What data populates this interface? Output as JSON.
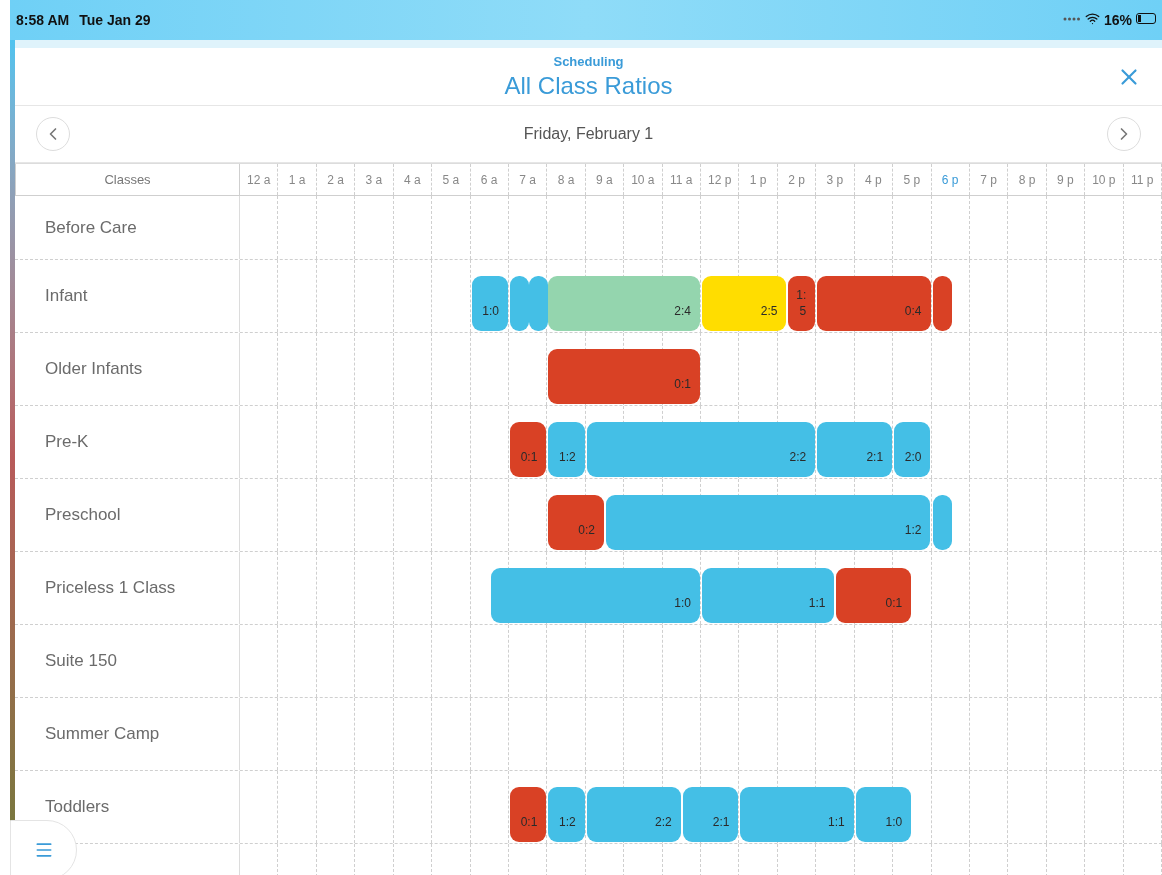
{
  "status_bar": {
    "time": "8:58 AM",
    "date": "Tue Jan 29",
    "battery": "16%"
  },
  "header": {
    "section": "Scheduling",
    "title": "All Class Ratios"
  },
  "date_nav": {
    "date": "Friday, February 1"
  },
  "grid": {
    "corner": "Classes",
    "hours": [
      {
        "label": "12 a",
        "selected": false
      },
      {
        "label": "1 a",
        "selected": false
      },
      {
        "label": "2 a",
        "selected": false
      },
      {
        "label": "3 a",
        "selected": false
      },
      {
        "label": "4 a",
        "selected": false
      },
      {
        "label": "5 a",
        "selected": false
      },
      {
        "label": "6 a",
        "selected": false
      },
      {
        "label": "7 a",
        "selected": false
      },
      {
        "label": "8 a",
        "selected": false
      },
      {
        "label": "9 a",
        "selected": false
      },
      {
        "label": "10 a",
        "selected": false
      },
      {
        "label": "11 a",
        "selected": false
      },
      {
        "label": "12 p",
        "selected": false
      },
      {
        "label": "1 p",
        "selected": false
      },
      {
        "label": "2 p",
        "selected": false
      },
      {
        "label": "3 p",
        "selected": false
      },
      {
        "label": "4 p",
        "selected": false
      },
      {
        "label": "5 p",
        "selected": false
      },
      {
        "label": "6 p",
        "selected": true
      },
      {
        "label": "7 p",
        "selected": false
      },
      {
        "label": "8 p",
        "selected": false
      },
      {
        "label": "9 p",
        "selected": false
      },
      {
        "label": "10 p",
        "selected": false
      },
      {
        "label": "11 p",
        "selected": false
      }
    ],
    "rows": [
      {
        "name": "Before Care",
        "bars": []
      },
      {
        "name": "Infant",
        "bars": [
          {
            "color": "#44bfe6",
            "label": "1:0"
          },
          {
            "color": "#44bfe6"
          },
          {
            "color": "#44bfe6"
          },
          {
            "color": "#94d5ae",
            "label": "2:4"
          },
          {
            "color": "#ffdd00",
            "label": "2:5"
          },
          {
            "color": "#d94125",
            "label": "1:5"
          },
          {
            "color": "#d94125",
            "label": "0:4"
          },
          {
            "color": "#d94125"
          }
        ]
      },
      {
        "name": "Older Infants",
        "bars": [
          {
            "color": "#d94125",
            "label": "0:1"
          }
        ]
      },
      {
        "name": "Pre-K",
        "bars": [
          {
            "color": "#d94125",
            "label": "0:1"
          },
          {
            "color": "#44bfe6",
            "label": "1:2"
          },
          {
            "color": "#44bfe6",
            "label": "2:2"
          },
          {
            "color": "#44bfe6",
            "label": "2:1"
          },
          {
            "color": "#44bfe6",
            "label": "2:0"
          }
        ]
      },
      {
        "name": "Preschool",
        "bars": [
          {
            "color": "#d94125",
            "label": "0:2"
          },
          {
            "color": "#44bfe6",
            "label": "1:2"
          },
          {
            "color": "#44bfe6"
          }
        ]
      },
      {
        "name": "Priceless 1 Class",
        "bars": [
          {
            "color": "#44bfe6",
            "label": "1:0"
          },
          {
            "color": "#44bfe6",
            "label": "1:1"
          },
          {
            "color": "#d94125",
            "label": "0:1"
          }
        ]
      },
      {
        "name": "Suite 150",
        "bars": []
      },
      {
        "name": "Summer Camp",
        "bars": []
      },
      {
        "name": "Toddlers",
        "bars": [
          {
            "color": "#d94125",
            "label": "0:1"
          },
          {
            "color": "#44bfe6",
            "label": "1:2"
          },
          {
            "color": "#44bfe6",
            "label": "2:2"
          },
          {
            "color": "#44bfe6",
            "label": "2:1"
          },
          {
            "color": "#44bfe6",
            "label": "1:1"
          },
          {
            "color": "#44bfe6",
            "label": "1:0"
          }
        ]
      }
    ]
  }
}
